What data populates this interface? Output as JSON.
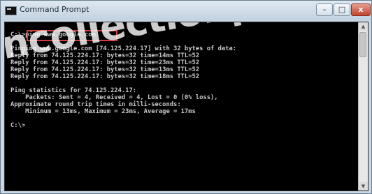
{
  "window": {
    "title": "Command Prompt",
    "minimize_glyph": "–",
    "maximize_glyph": "□",
    "close_glyph": "x"
  },
  "console": {
    "lines": [
      "C:\\>ping www.google.com",
      "",
      "Pinging www.google.com [74.125.224.17] with 32 bytes of data:",
      "Reply from 74.125.224.17: bytes=32 time=14ms TTL=52",
      "Reply from 74.125.224.17: bytes=32 time=23ms TTL=52",
      "Reply from 74.125.224.17: bytes=32 time=13ms TTL=52",
      "Reply from 74.125.224.17: bytes=32 time=18ms TTL=52",
      "",
      "Ping statistics for 74.125.224.17:",
      "    Packets: Sent = 4, Received = 4, Lost = 0 (0% loss),",
      "Approximate round trip times in milli-seconds:",
      "    Minimum = 13ms, Maximum = 23ms, Average = 17ms",
      "",
      "C:\\>"
    ]
  },
  "watermark": "ncollectionpa",
  "scrollbar": {
    "up_glyph": "▲",
    "down_glyph": "▼"
  },
  "colors": {
    "console_background": "#000000",
    "console_text": "#c8c8c8",
    "highlight_border": "#d53d3d"
  }
}
